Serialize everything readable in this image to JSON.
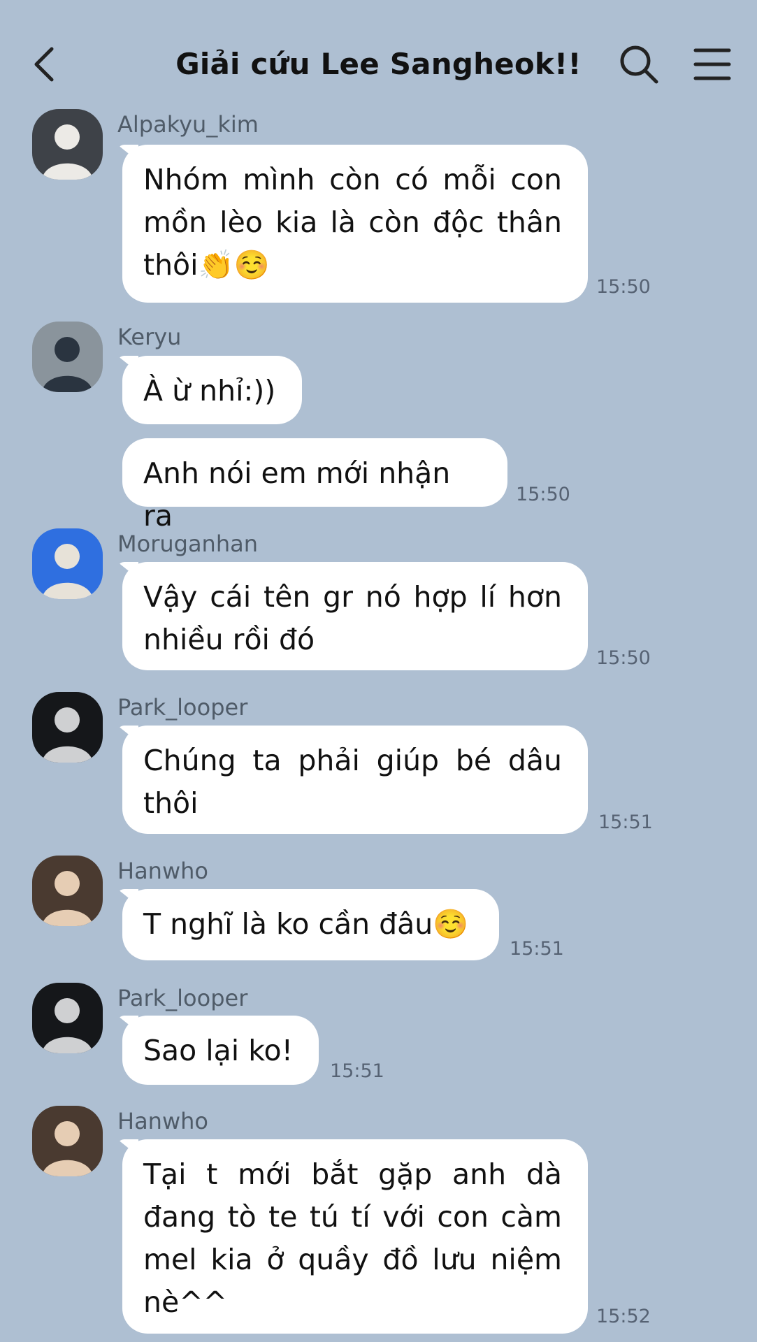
{
  "header": {
    "title": "Giải cứu Lee Sangheok!!",
    "back_icon": "chevron-left-icon",
    "search_icon": "search-icon",
    "menu_icon": "hamburger-menu-icon"
  },
  "colors": {
    "background": "#aebfd2",
    "bubble": "#ffffff",
    "sender_name": "#4f5b68",
    "timestamp": "#566273"
  },
  "messages": [
    {
      "sender": "Alpakyu_kim",
      "avatar": "avatar-alpakyu-kim",
      "bubbles": [
        "Nhóm mình còn có mỗi con mồn lèo kia là còn độc thân thôi👏☺️"
      ],
      "time": "15:50"
    },
    {
      "sender": "Keryu",
      "avatar": "avatar-keryu",
      "bubbles": [
        "À ừ nhỉ:))",
        "Anh nói em mới nhận ra"
      ],
      "time": "15:50"
    },
    {
      "sender": "Moruganhan",
      "avatar": "avatar-moruganhan",
      "bubbles": [
        "Vậy cái tên gr nó hợp lí hơn nhiều rồi đó"
      ],
      "time": "15:50"
    },
    {
      "sender": "Park_looper",
      "avatar": "avatar-park-looper",
      "bubbles": [
        "Chúng ta phải giúp bé dâu thôi"
      ],
      "time": "15:51"
    },
    {
      "sender": "Hanwho",
      "avatar": "avatar-hanwho",
      "bubbles": [
        "T nghĩ là ko cần đâu☺️"
      ],
      "time": "15:51"
    },
    {
      "sender": "Park_looper",
      "avatar": "avatar-park-looper",
      "bubbles": [
        "Sao lại ko!"
      ],
      "time": "15:51"
    },
    {
      "sender": "Hanwho",
      "avatar": "avatar-hanwho",
      "bubbles": [
        "Tại t mới bắt gặp anh dà đang tò te tú tí với con càm mel kia ở quầy đồ lưu niệm nè^^"
      ],
      "time": "15:52"
    }
  ]
}
